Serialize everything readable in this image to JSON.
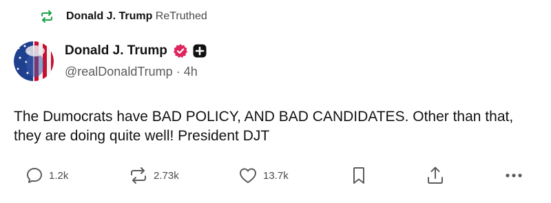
{
  "retruth_banner": {
    "author": "Donald J. Trump",
    "label": "ReTruthed",
    "icon": "retruth-icon"
  },
  "post": {
    "author_name": "Donald J. Trump",
    "handle": "@realDonaldTrump",
    "separator": "·",
    "time": "4h",
    "text": "The Dumocrats have BAD POLICY, AND BAD CANDIDATES. Other than that, they are doing quite well! President DJT",
    "badges": [
      "verified-icon",
      "plus-icon"
    ]
  },
  "actions": {
    "replies": "1.2k",
    "retruths": "2.73k",
    "likes": "13.7k"
  },
  "colors": {
    "retruth_green": "#16a34a",
    "verified_pink": "#e0245e",
    "text_primary": "#111111",
    "text_secondary": "#5b5b5b"
  }
}
